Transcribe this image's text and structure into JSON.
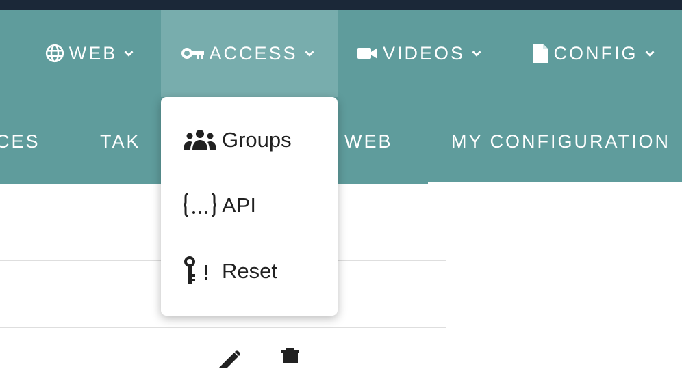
{
  "navbar": {
    "items": [
      {
        "label": "WEB",
        "icon": "globe-icon"
      },
      {
        "label": "ACCESS",
        "icon": "key-icon"
      },
      {
        "label": "VIDEOS",
        "icon": "videocam-icon"
      },
      {
        "label": "CONFIG",
        "icon": "file-icon"
      }
    ],
    "active": "ACCESS"
  },
  "tabs": [
    "CES",
    "TAK",
    "WEB",
    "MY CONFIGURATION"
  ],
  "access_menu": {
    "items": [
      {
        "label": "Groups",
        "icon": "groups-icon"
      },
      {
        "label": "API",
        "icon": "api-braces-icon"
      },
      {
        "label": "Reset",
        "icon": "key-reset-icon"
      }
    ]
  },
  "row_actions": [
    "edit-icon",
    "delete-icon"
  ],
  "colors": {
    "topstrip": "#1b2838",
    "navbar": "#5f9c9c",
    "nav_active": "#78adad",
    "menu_text": "#212121"
  }
}
